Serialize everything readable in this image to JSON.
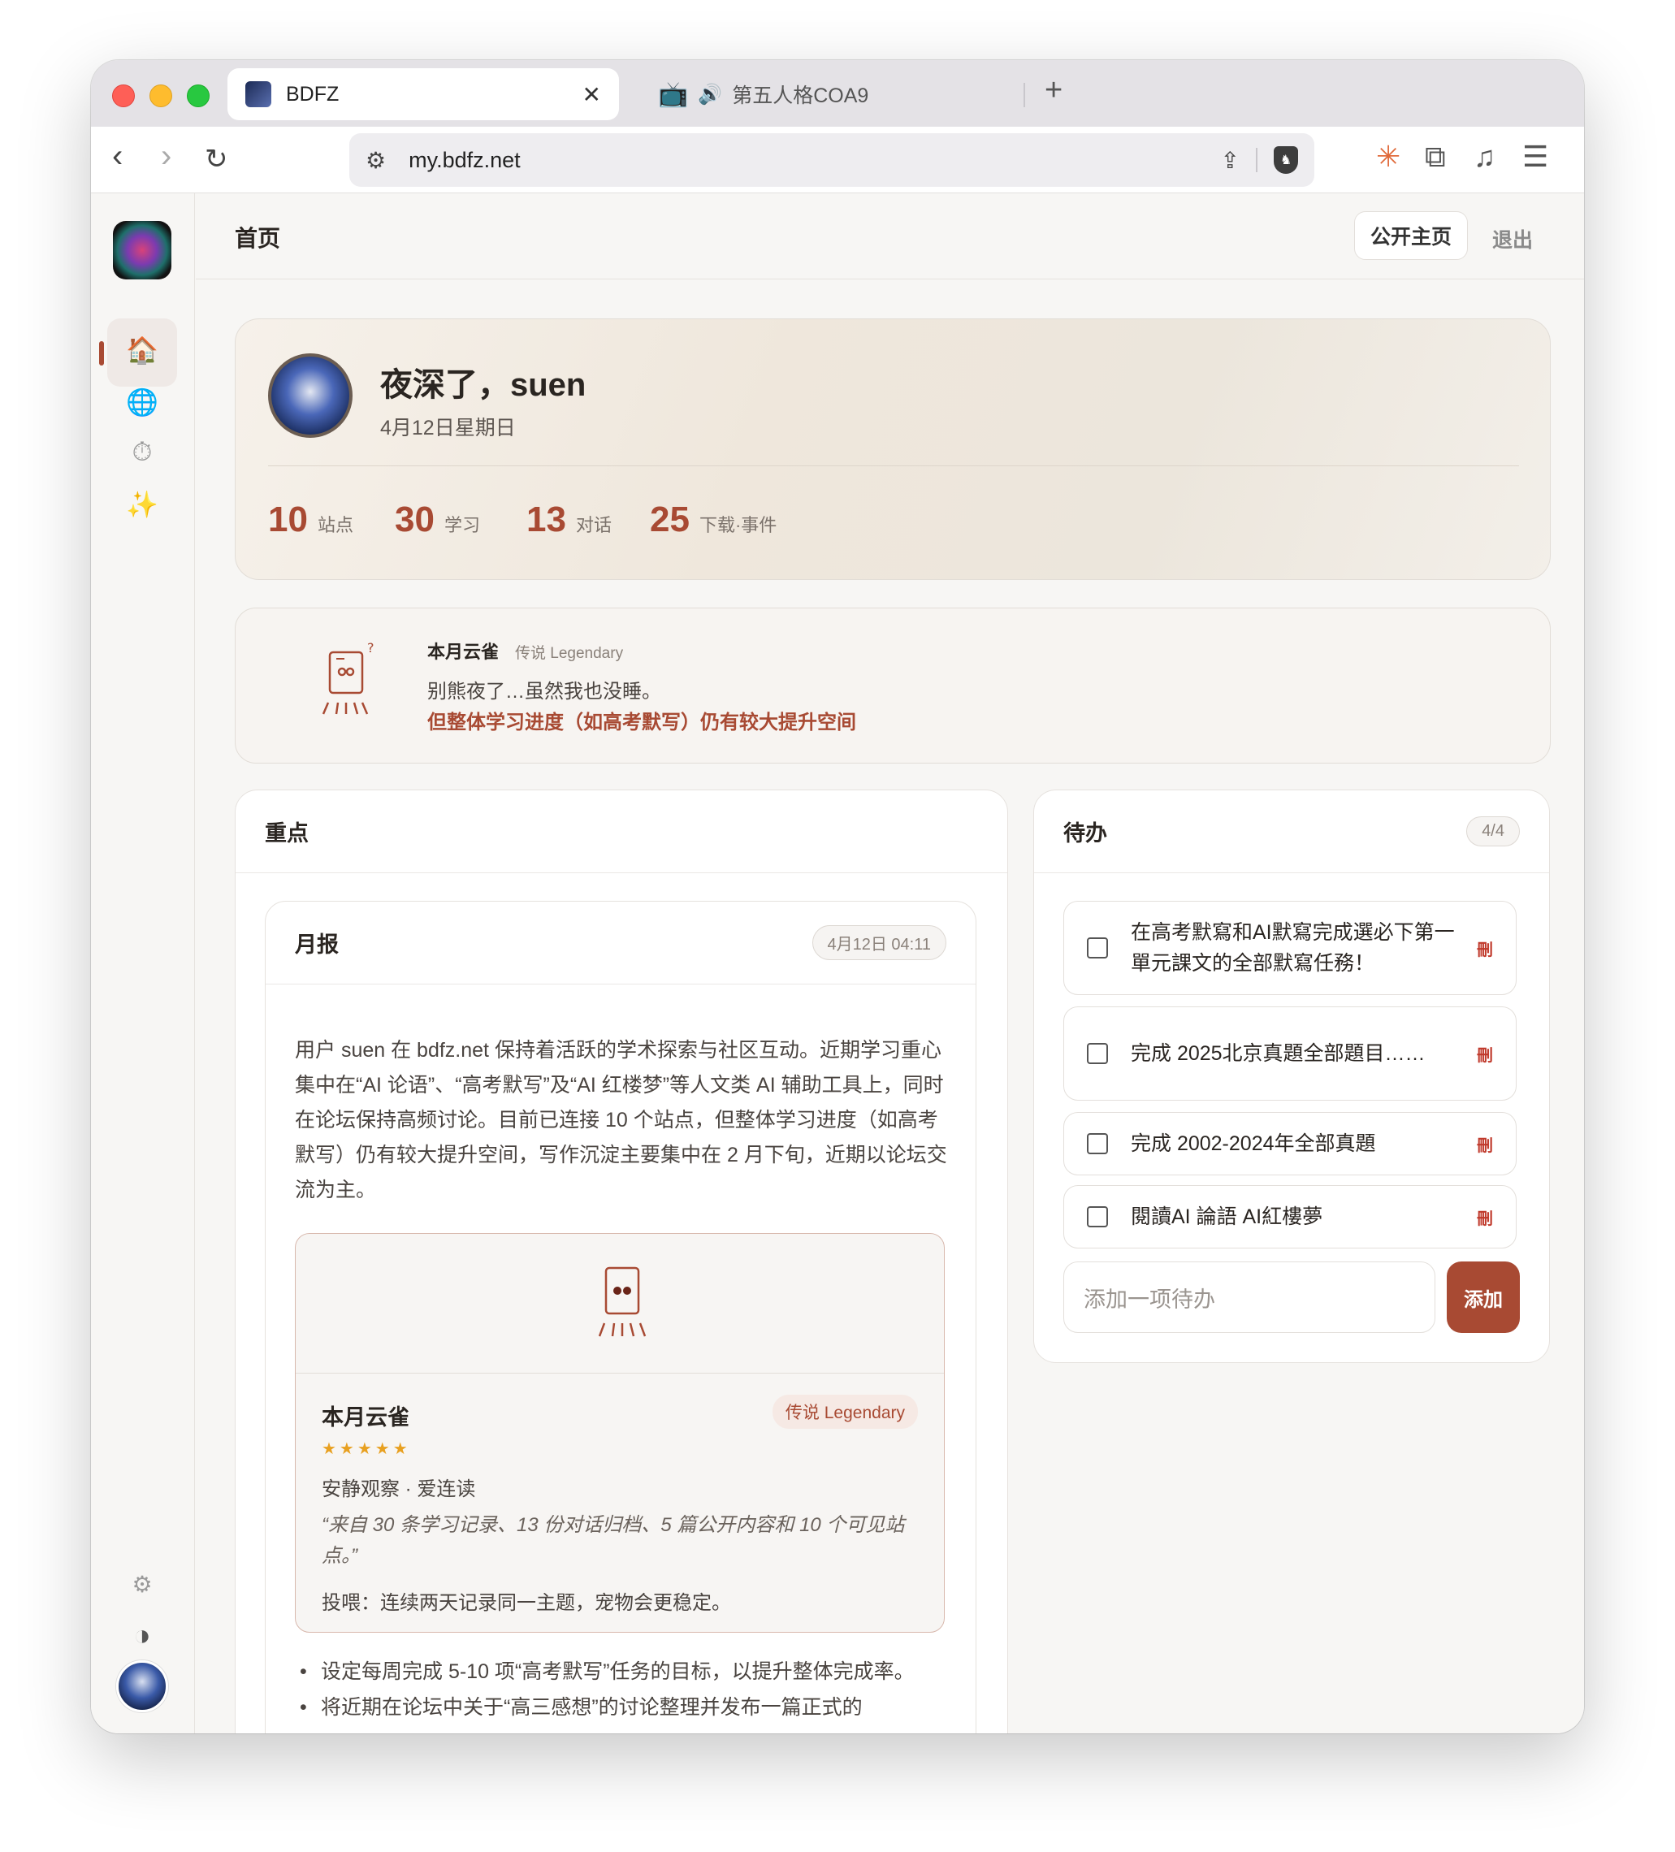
{
  "browser": {
    "tabs": [
      {
        "title": "BDFZ",
        "active": true
      },
      {
        "title": "第五人格COA9",
        "active": false
      }
    ],
    "url": "my.bdfz.net"
  },
  "header": {
    "title": "首页",
    "public_label": "公开主页",
    "logout_label": "退出"
  },
  "hero": {
    "greeting": "夜深了，suen",
    "date": "4月12日星期日",
    "stats": [
      {
        "value": "10",
        "label": "站点"
      },
      {
        "value": "30",
        "label": "学习"
      },
      {
        "value": "13",
        "label": "对话"
      },
      {
        "value": "25",
        "label": "下载·事件"
      }
    ]
  },
  "alert": {
    "pet_name": "本月云雀",
    "pet_rank": "传说 Legendary",
    "message": "别熊夜了…虽然我也没睡。",
    "highlight": "但整体学习进度（如高考默写）仍有较大提升空间"
  },
  "highlights": {
    "title": "重点",
    "report": {
      "title": "月报",
      "timestamp": "4月12日 04:11",
      "text": "用户 suen 在 bdfz.net 保持着活跃的学术探索与社区互动。近期学习重心集中在“AI 论语”、“高考默写”及“AI 红楼梦”等人文类 AI 辅助工具上，同时在论坛保持高频讨论。目前已连接 10 个站点，但整体学习进度（如高考默写）仍有较大提升空间，写作沉淀主要集中在 2 月下旬，近期以论坛交流为主。",
      "pet": {
        "name": "本月云雀",
        "rank": "传说 Legendary",
        "stars": "★★★★★",
        "traits": "安静观察 · 爱连读",
        "quote": "“来自 30 条学习记录、13 份对话归档、5 篇公开内容和 10 个可见站点。”",
        "feed": "投喂：连续两天记录同一主题，宠物会更稳定。"
      },
      "bullets": [
        "设定每周完成 5-10 项“高考默写”任务的目标，以提升整体完成率。",
        "将近期在论坛中关于“高三感想”的讨论整理并发布一篇正式的"
      ]
    }
  },
  "todo": {
    "title": "待办",
    "count": "4/4",
    "items": [
      {
        "text": "在高考默寫和AI默寫完成選必下第一單元課文的全部默寫任務！",
        "delete": "刪"
      },
      {
        "text": "完成 2025北京真題全部題目……",
        "delete": "刪"
      },
      {
        "text": "完成 2002-2024年全部真題",
        "delete": "刪"
      },
      {
        "text": "閱讀AI 論語 AI紅樓夢",
        "delete": "刪"
      }
    ],
    "input_placeholder": "添加一项待办",
    "add_label": "添加"
  },
  "colors": {
    "accent": "#a84a33",
    "background": "#f7f6f4"
  }
}
